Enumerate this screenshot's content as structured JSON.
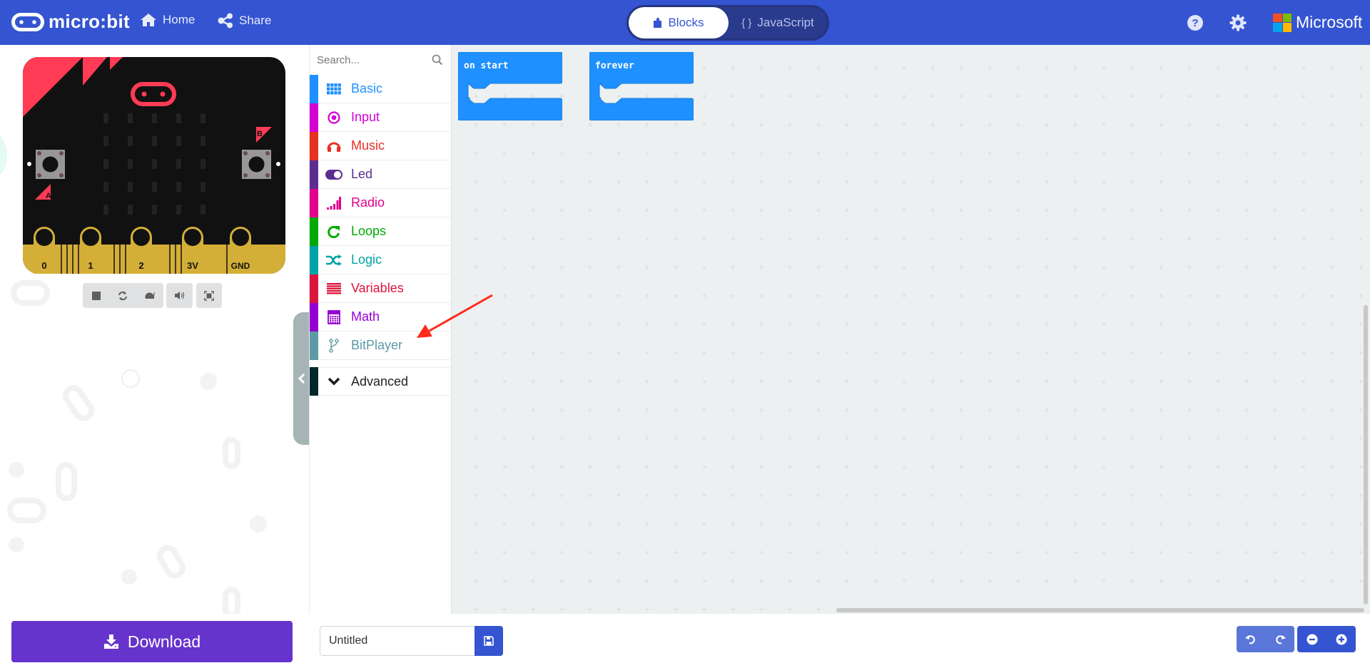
{
  "header": {
    "logo_text": "micro:bit",
    "nav": [
      {
        "label": "Home",
        "icon": "home-icon"
      },
      {
        "label": "Share",
        "icon": "share-icon"
      }
    ],
    "editor_toggle": {
      "blocks_label": "Blocks",
      "javascript_label": "JavaScript",
      "javascript_glyph": "{ }",
      "active": "Blocks"
    },
    "help_icon": "help-icon",
    "settings_icon": "gear-icon",
    "brand_label": "Microsoft",
    "colors": {
      "bar": "#3454d1"
    }
  },
  "simulator": {
    "pins": [
      "0",
      "1",
      "2",
      "3V",
      "GND"
    ],
    "button_a_label": "A",
    "button_b_label": "B",
    "controls": [
      "stop-icon",
      "restart-icon",
      "slow-motion-icon",
      "mute-icon",
      "fullscreen-icon"
    ],
    "led_rows": 5,
    "led_cols": 5
  },
  "toolbox": {
    "search_placeholder": "Search...",
    "categories": [
      {
        "label": "Basic",
        "color": "#1e90ff",
        "icon": "grid-icon"
      },
      {
        "label": "Input",
        "color": "#d400d4",
        "icon": "radio-button-icon"
      },
      {
        "label": "Music",
        "color": "#e63022",
        "icon": "headphones-icon"
      },
      {
        "label": "Led",
        "color": "#5c2d91",
        "icon": "toggle-icon"
      },
      {
        "label": "Radio",
        "color": "#e3008c",
        "icon": "signal-icon"
      },
      {
        "label": "Loops",
        "color": "#00aa00",
        "icon": "refresh-icon"
      },
      {
        "label": "Logic",
        "color": "#00a4a6",
        "icon": "shuffle-icon"
      },
      {
        "label": "Variables",
        "color": "#dc143c",
        "icon": "list-icon"
      },
      {
        "label": "Math",
        "color": "#9400d3",
        "icon": "calculator-icon"
      },
      {
        "label": "BitPlayer",
        "color": "#5e9aa5",
        "icon": "branch-icon"
      }
    ],
    "advanced": {
      "label": "Advanced",
      "color": "#00272b",
      "icon": "chevron-down-icon"
    }
  },
  "workspace": {
    "blocks": [
      {
        "label": "on start",
        "color": "#1e90ff"
      },
      {
        "label": "forever",
        "color": "#1e90ff"
      }
    ]
  },
  "bottom": {
    "download_label": "Download",
    "project_name": "Untitled",
    "save_icon": "save-icon",
    "undo_icon": "undo-icon",
    "redo_icon": "redo-icon",
    "zoom_out_icon": "zoom-out-icon",
    "zoom_in_icon": "zoom-in-icon"
  },
  "annotation": {
    "type": "arrow",
    "color": "#ff2a1a",
    "points_to": "BitPlayer"
  }
}
